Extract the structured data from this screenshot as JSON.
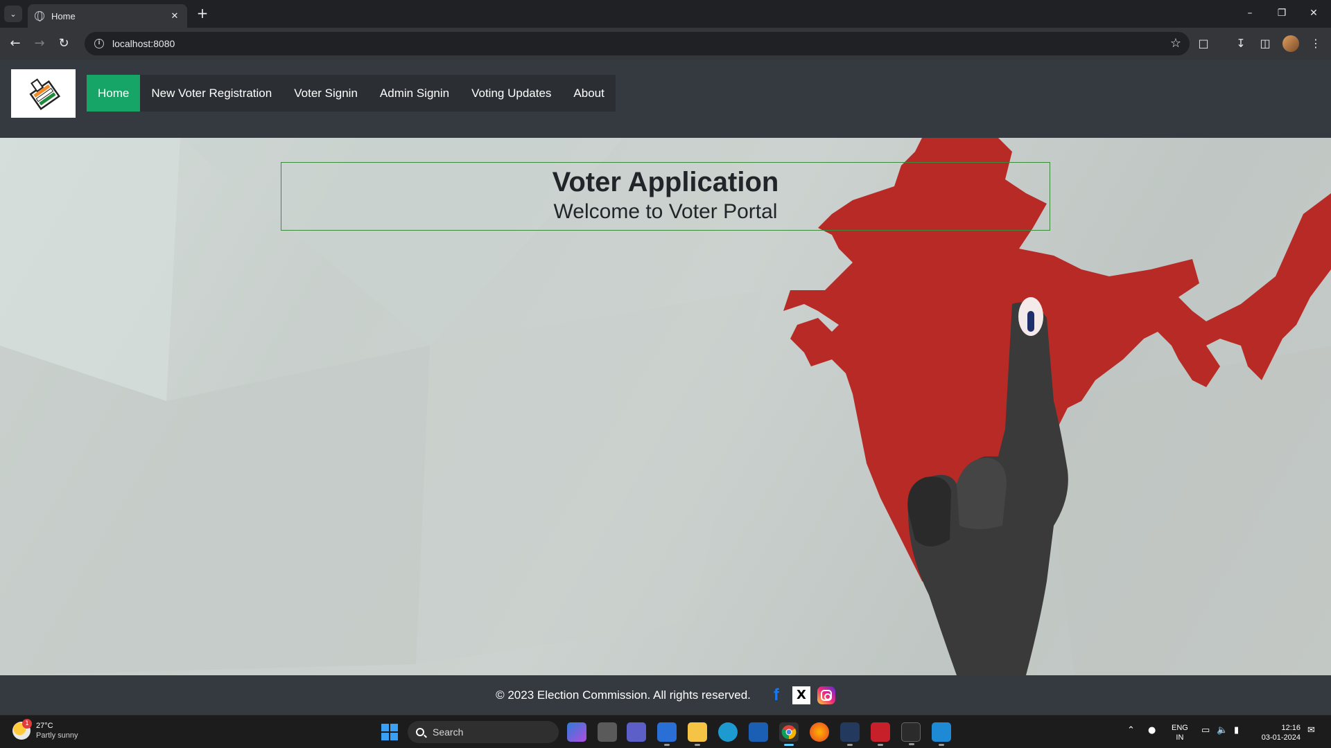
{
  "browser": {
    "tab_title": "Home",
    "url": "localhost:8080"
  },
  "site": {
    "nav": [
      {
        "label": "Home",
        "active": true
      },
      {
        "label": "New Voter Registration",
        "active": false
      },
      {
        "label": "Voter Signin",
        "active": false
      },
      {
        "label": "Admin Signin",
        "active": false
      },
      {
        "label": "Voting Updates",
        "active": false
      },
      {
        "label": "About",
        "active": false
      }
    ],
    "banner_title": "Voter Application",
    "banner_subtitle": "Welcome to Voter Portal",
    "footer_text": "© 2023 Election Commission. All rights reserved.",
    "social": [
      "facebook-icon",
      "x-icon",
      "instagram-icon"
    ],
    "accent_color": "#16a566",
    "header_color": "#343a40",
    "map_color": "#b82a26"
  },
  "taskbar": {
    "weather_temp": "27°C",
    "weather_desc": "Partly sunny",
    "weather_badge": "1",
    "search_label": "Search",
    "lang_line1": "ENG",
    "lang_line2": "IN",
    "time": "12:16",
    "date": "03-01-2024"
  }
}
